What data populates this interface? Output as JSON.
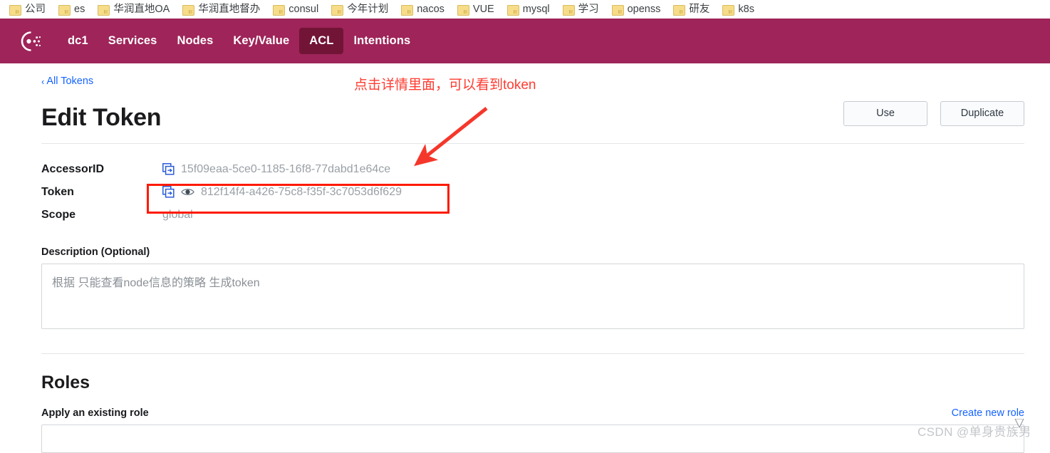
{
  "browser": {
    "bookmarks": [
      {
        "label": "公司",
        "icon": "folder-icon"
      },
      {
        "label": "es",
        "icon": "folder-icon"
      },
      {
        "label": "华润直地OA",
        "icon": "folder-icon"
      },
      {
        "label": "华润直地督办",
        "icon": "folder-icon"
      },
      {
        "label": "consul",
        "icon": "folder-icon"
      },
      {
        "label": "今年计划",
        "icon": "folder-icon"
      },
      {
        "label": "nacos",
        "icon": "folder-icon"
      },
      {
        "label": "VUE",
        "icon": "folder-icon"
      },
      {
        "label": "mysql",
        "icon": "folder-icon"
      },
      {
        "label": "学习",
        "icon": "folder-icon"
      },
      {
        "label": "openss",
        "icon": "folder-icon"
      },
      {
        "label": "研友",
        "icon": "folder-icon"
      },
      {
        "label": "k8s",
        "icon": "folder-icon"
      }
    ]
  },
  "topnav": {
    "logo_name": "consul-logo-icon",
    "background_color": "#9e2459",
    "active_background_color": "#721436",
    "items": [
      {
        "label": "dc1",
        "active": false
      },
      {
        "label": "Services",
        "active": false
      },
      {
        "label": "Nodes",
        "active": false
      },
      {
        "label": "Key/Value",
        "active": false
      },
      {
        "label": "ACL",
        "active": true
      },
      {
        "label": "Intentions",
        "active": false
      }
    ]
  },
  "page": {
    "breadcrumb_chevron": "‹",
    "breadcrumb_label": "All Tokens",
    "title": "Edit Token",
    "buttons": {
      "use_label": "Use",
      "duplicate_label": "Duplicate"
    },
    "details": [
      {
        "label": "AccessorID",
        "value": "15f09eaa-5ce0-1185-16f8-77dabd1e64ce",
        "has_copy": true,
        "has_eye": false
      },
      {
        "label": "Token",
        "value": "812f14f4-a426-75c8-f35f-3c7053d6f629",
        "has_copy": true,
        "has_eye": true
      },
      {
        "label": "Scope",
        "value": "global",
        "has_copy": false,
        "has_eye": false
      }
    ],
    "description": {
      "label": "Description (Optional)",
      "value": "根据 只能查看node信息的策略 生成token"
    },
    "roles": {
      "section_title": "Roles",
      "apply_label": "Apply an existing role",
      "create_link": "Create new role",
      "input_value": ""
    }
  },
  "annotations": {
    "note_text": "点击详情里面，可以看到token",
    "note_color": "#ff3b30",
    "arrow_color": "#f5372b",
    "box_color": "#ff1a00"
  },
  "watermark": {
    "text": "CSDN @单身贵族男"
  }
}
